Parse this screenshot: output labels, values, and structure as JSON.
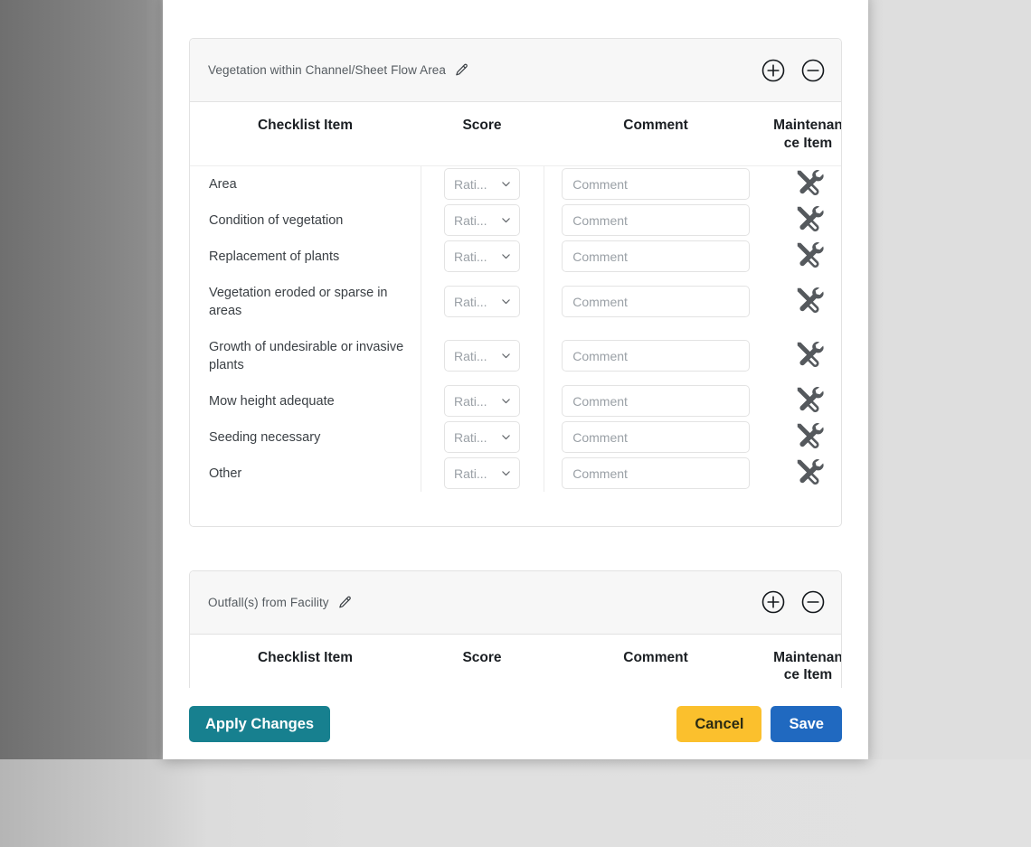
{
  "modal": {
    "panels": [
      {
        "title": "Vegetation within Channel/Sheet Flow Area",
        "edit_icon": "pencil-icon",
        "add_icon": "plus-circle-icon",
        "remove_icon": "minus-circle-icon",
        "columns": [
          "Checklist Item",
          "Score",
          "Comment",
          "Maintenance Item"
        ],
        "rows": [
          {
            "item": "Area",
            "score": "Rati...",
            "comment": "",
            "comment_placeholder": "Comment",
            "maintenance_icon": "tools-icon"
          },
          {
            "item": "Condition of vegetation",
            "score": "Rati...",
            "comment": "",
            "comment_placeholder": "Comment",
            "maintenance_icon": "tools-icon"
          },
          {
            "item": "Replacement of plants",
            "score": "Rati...",
            "comment": "",
            "comment_placeholder": "Comment",
            "maintenance_icon": "tools-icon"
          },
          {
            "item": "Vegetation eroded or sparse in areas",
            "score": "Rati...",
            "comment": "",
            "comment_placeholder": "Comment",
            "maintenance_icon": "tools-icon"
          },
          {
            "item": "Growth of undesirable or invasive plants",
            "score": "Rati...",
            "comment": "",
            "comment_placeholder": "Comment",
            "maintenance_icon": "tools-icon"
          },
          {
            "item": "Mow height adequate",
            "score": "Rati...",
            "comment": "",
            "comment_placeholder": "Comment",
            "maintenance_icon": "tools-icon"
          },
          {
            "item": "Seeding necessary",
            "score": "Rati...",
            "comment": "",
            "comment_placeholder": "Comment",
            "maintenance_icon": "tools-icon"
          },
          {
            "item": "Other",
            "score": "Rati...",
            "comment": "",
            "comment_placeholder": "Comment",
            "maintenance_icon": "tools-icon"
          }
        ]
      },
      {
        "title": "Outfall(s) from Facility",
        "edit_icon": "pencil-icon",
        "add_icon": "plus-circle-icon",
        "remove_icon": "minus-circle-icon",
        "columns": [
          "Checklist Item",
          "Score",
          "Comment",
          "Maintenance Item"
        ],
        "rows": []
      }
    ],
    "footer": {
      "apply_label": "Apply Changes",
      "cancel_label": "Cancel",
      "save_label": "Save"
    }
  },
  "colors": {
    "apply": "#17808f",
    "cancel": "#fbc02d",
    "save": "#2069c0",
    "panel_header_bg": "#f7f7f7",
    "border": "#e2e2e2",
    "placeholder": "#9aa0a6"
  }
}
